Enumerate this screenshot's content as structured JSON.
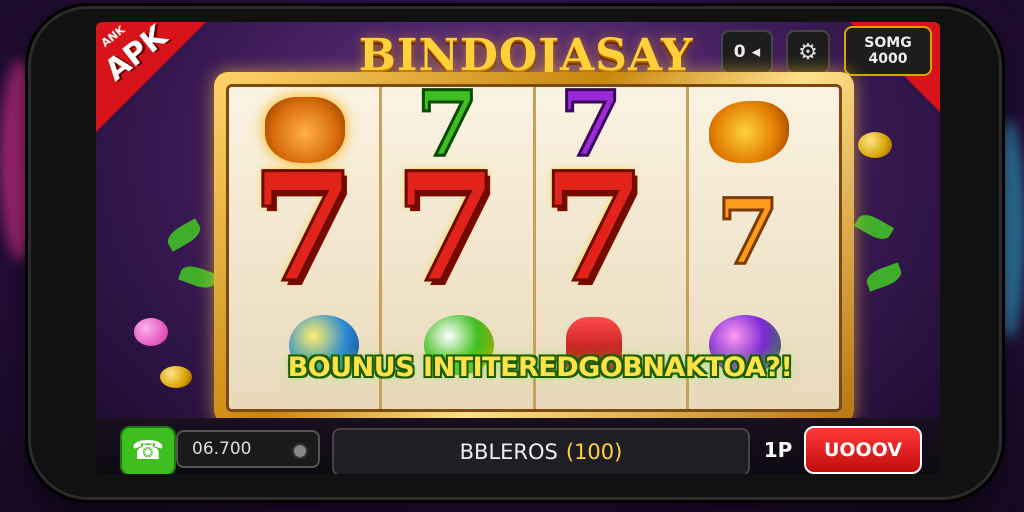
{
  "badge": {
    "small": "ANK",
    "main": "APK"
  },
  "title": "BINDOJASAY",
  "hud": {
    "left_value": "0",
    "left_icon": "◂",
    "gear": "⚙",
    "right_line1": "SOMG",
    "right_line2": "4000"
  },
  "reels": [
    {
      "top_symbol": "tiger-icon",
      "middle": "7",
      "bottom_symbol": "ball-icon"
    },
    {
      "top_symbol": "7",
      "middle": "7",
      "bottom_symbol": "ball-icon"
    },
    {
      "top_symbol": "7",
      "middle": "7",
      "bottom_symbol": "bell-icon"
    },
    {
      "top_symbol": "fish-icon",
      "middle": "7",
      "bottom_symbol": "ball-icon"
    }
  ],
  "bonus_text": "BOUNUS INTITEREDGOBNAKTOA?!",
  "controls": {
    "call_icon": "☎",
    "balance": "06.700",
    "bet_label": "BBLEROS",
    "bet_value": "(100)",
    "lines_label": "1P",
    "spin_label": "UOOOV"
  },
  "colors": {
    "accent_gold": "#ffd23a",
    "reel_red": "#e2231a",
    "spin_red": "#c20b0b",
    "call_green": "#3fbf1f",
    "badge_red": "#d8141a"
  }
}
